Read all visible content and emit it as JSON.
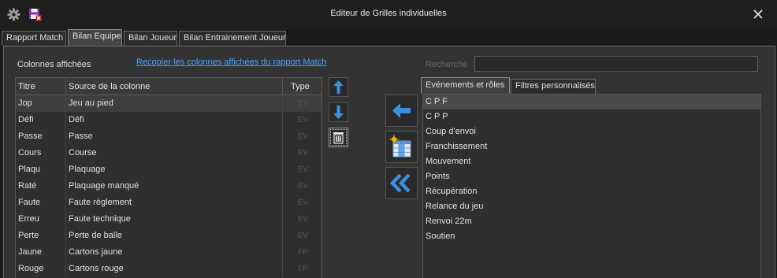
{
  "window": {
    "title": "Editeur de Grilles individuelles"
  },
  "tabs": [
    "Rapport Match",
    "Bilan Equipe",
    "Bilan Joueur",
    "Bilan Entrainement Joueur"
  ],
  "active_tab": "Bilan Equipe",
  "columns_section": {
    "label": "Colonnes affichées",
    "copy_link": "Recopier les colonnes affichées du rapport Match"
  },
  "search": {
    "label": "Recherche",
    "value": ""
  },
  "grid": {
    "headers": [
      "Titre",
      "Source de la colonne",
      "Type"
    ],
    "rows": [
      {
        "titre": "Jop",
        "source": "Jeu au pied",
        "type": "EV"
      },
      {
        "titre": "Défi",
        "source": "Défi",
        "type": "EV"
      },
      {
        "titre": "Passe",
        "source": "Passe",
        "type": "EV"
      },
      {
        "titre": "Cours",
        "source": "Course",
        "type": "EV"
      },
      {
        "titre": "Plaqu",
        "source": "Plaquage",
        "type": "EV"
      },
      {
        "titre": "Raté",
        "source": "Plaquage manqué",
        "type": "EV"
      },
      {
        "titre": "Faute",
        "source": "Faute règlement",
        "type": "EV"
      },
      {
        "titre": "Erreu",
        "source": "Faute technique",
        "type": "EV"
      },
      {
        "titre": "Perte",
        "source": "Perte de balle",
        "type": "EV"
      },
      {
        "titre": "Jaune",
        "source": "Cartons jaune",
        "type": "FP"
      },
      {
        "titre": "Rouge",
        "source": "Cartons rouge",
        "type": "FP"
      }
    ]
  },
  "right_tabs": [
    "Evénements et rôles",
    "Filtres personnalisés"
  ],
  "right_active_tab": "Evénements et rôles",
  "events": [
    "C P F",
    "C P P",
    "Coup d'envoi",
    "Franchissement",
    "Mouvement",
    "Points",
    "Récupération",
    "Relance du jeu",
    "Renvoi 22m",
    "Soutien"
  ],
  "colors": {
    "accent": "#4ba3ff",
    "arrow": "#3f8fe0",
    "background": "#333333"
  },
  "icons": [
    "gear-icon",
    "save-delete-icon",
    "close-icon",
    "arrow-up-icon",
    "arrow-down-icon",
    "delete-column-icon",
    "arrow-left-icon",
    "new-grid-icon",
    "double-arrow-left-icon"
  ]
}
